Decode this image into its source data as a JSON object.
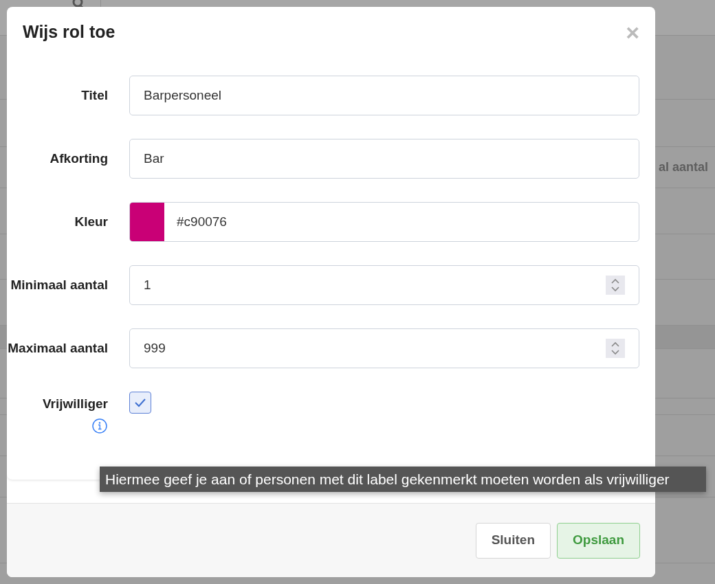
{
  "background": {
    "column_header": "al aantal"
  },
  "dialog": {
    "title": "Wijs rol toe",
    "close": "×"
  },
  "fields": [
    {
      "kind": "text",
      "label": "Titel",
      "value": "Barpersoneel"
    },
    {
      "kind": "text",
      "label": "Afkorting",
      "value": "Bar"
    },
    {
      "kind": "color",
      "label": "Kleur",
      "value": "#c90076",
      "color": "#c90076"
    },
    {
      "kind": "number",
      "label": "Minimaal aantal",
      "value": "1"
    },
    {
      "kind": "number",
      "label": "Maximaal aantal",
      "value": "999"
    },
    {
      "kind": "checkbox",
      "label": "Vrijwilliger",
      "checked": true,
      "tooltip": "Hiermee geef je aan of personen met dit label gekenmerkt moeten worden als vrijwilliger"
    }
  ],
  "buttons": [
    {
      "label": "Sluiten",
      "kind": "secondary"
    },
    {
      "label": "Opslaan",
      "kind": "primary"
    }
  ]
}
